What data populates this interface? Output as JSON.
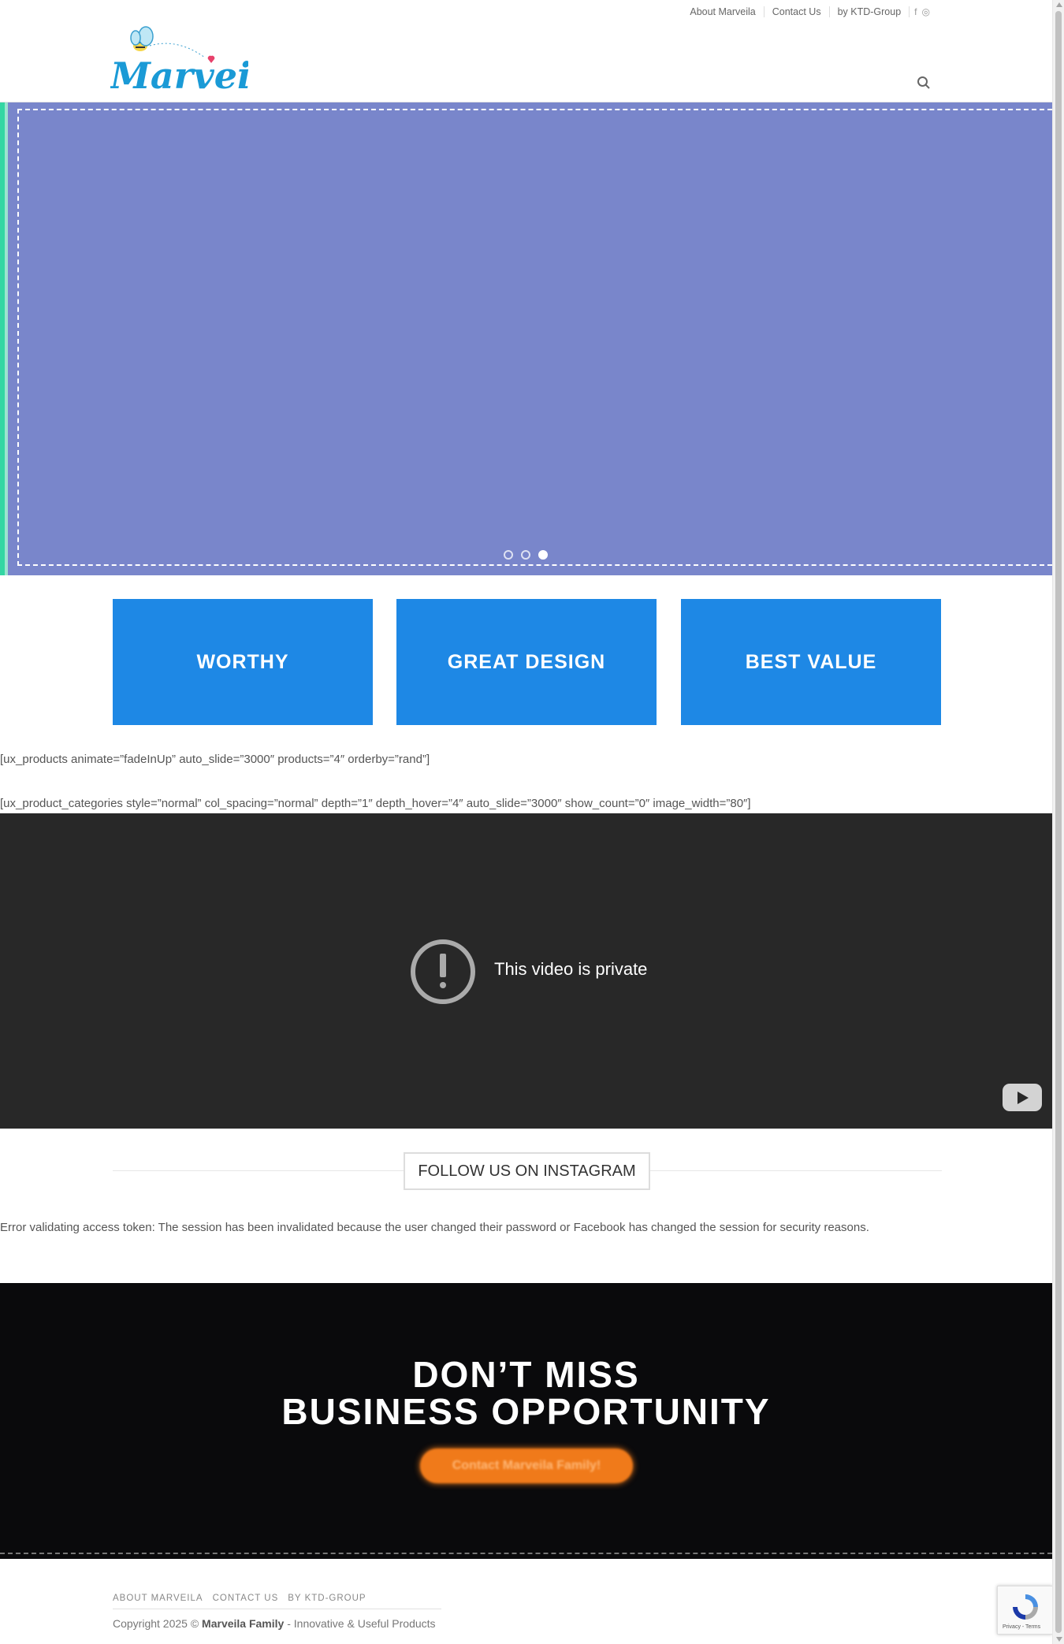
{
  "header": {
    "top_nav": [
      {
        "label": "About Marveila"
      },
      {
        "label": "Contact Us"
      },
      {
        "label": "by KTD-Group"
      }
    ],
    "social": {
      "facebook": "f",
      "instagram": "◎"
    },
    "logo_text": "Marveila",
    "search_icon": "search-icon"
  },
  "slider": {
    "background": "#7986cb",
    "dots_total": 3,
    "active_dot": 3
  },
  "features": [
    {
      "label": "WORTHY"
    },
    {
      "label": "GREAT DESIGN"
    },
    {
      "label": "BEST VALUE"
    }
  ],
  "shortcodes": {
    "products": "[ux_products animate=”fadeInUp” auto_slide=”3000″ products=”4″ orderby=”rand”]",
    "categories": "[ux_product_categories style=”normal” col_spacing=”normal” depth=”1″ depth_hover=”4″ auto_slide=”3000″ show_count=”0″ image_width=”80″]"
  },
  "video": {
    "message": "This video is private"
  },
  "instagram": {
    "title": "FOLLOW US ON INSTAGRAM",
    "error": "Error validating access token: The session has been invalidated because the user changed their password or Facebook has changed the session for security reasons."
  },
  "cta": {
    "line1": "DON’T MISS",
    "line2": "BUSINESS OPPORTUNITY",
    "button": "Contact Marveila Family!",
    "button_color": "#f07a1a"
  },
  "footer": {
    "nav": [
      {
        "label": "ABOUT MARVEILA"
      },
      {
        "label": "CONTACT US"
      },
      {
        "label": "BY KTD-GROUP"
      }
    ],
    "copyright_prefix": "Copyright 2025 ©",
    "brand": "Marveila Family",
    "tagline": "- Innovative & Useful Products"
  },
  "recaptcha": {
    "links": "Privacy - Terms"
  }
}
